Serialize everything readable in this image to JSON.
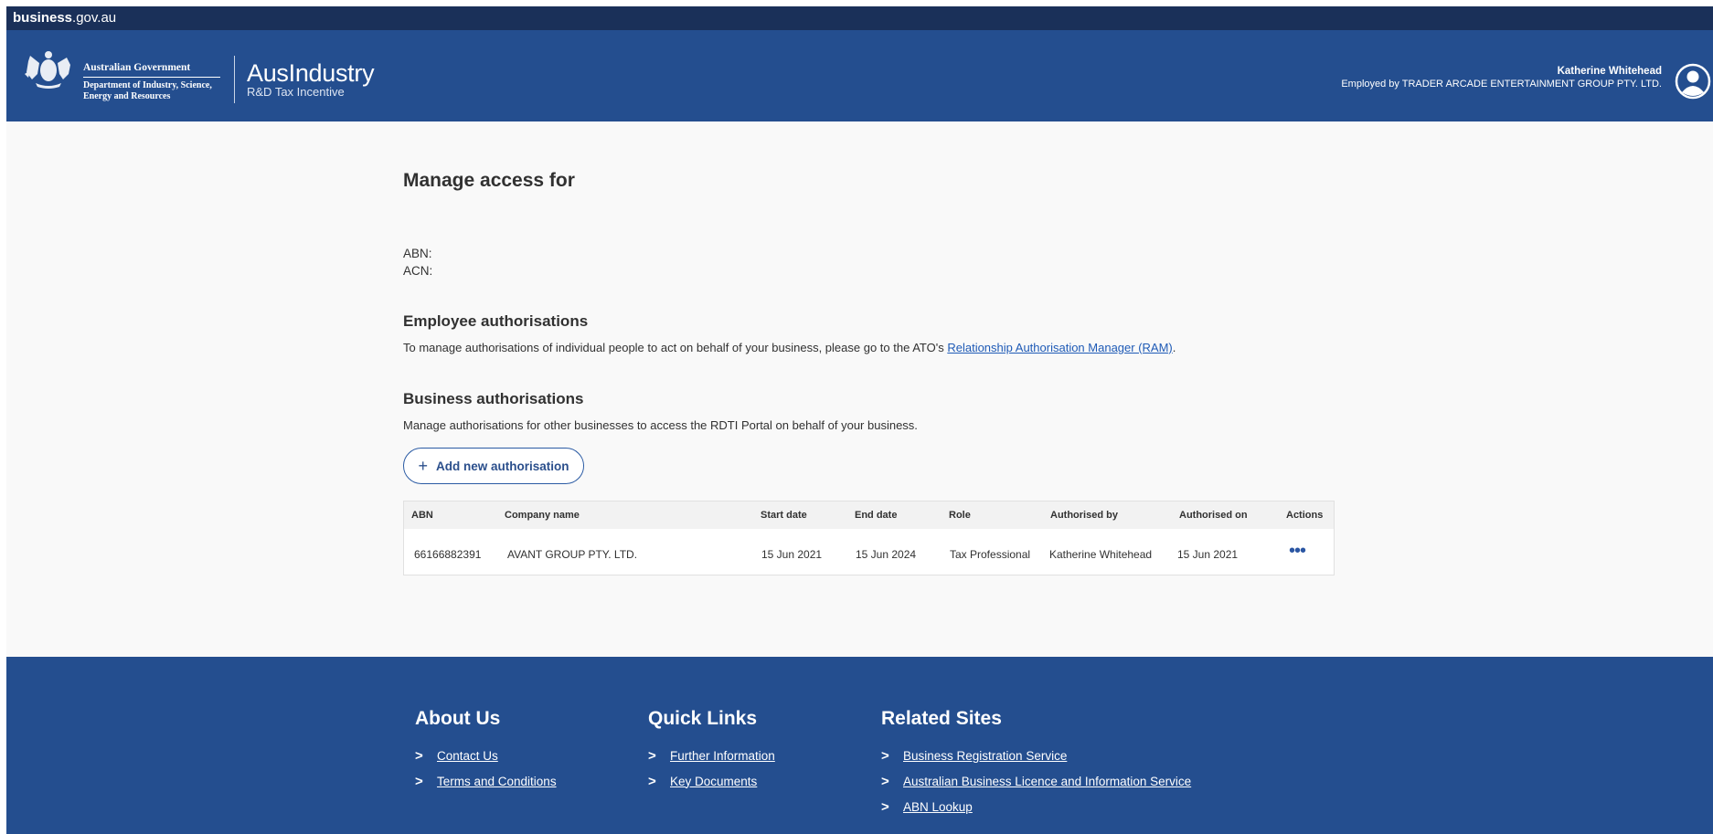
{
  "topstrip": {
    "brand_bold": "business",
    "brand_rest": ".gov.au"
  },
  "header": {
    "gov_name": "Australian Government",
    "dept_line1": "Department of Industry, Science,",
    "dept_line2": "Energy and Resources",
    "program_name": "AusIndustry",
    "program_sub": "R&D Tax Incentive",
    "user_name": "Katherine Whitehead",
    "user_employer": "Employed by TRADER ARCADE ENTERTAINMENT GROUP PTY. LTD."
  },
  "main": {
    "title": "Manage access for",
    "abn_label": "ABN:",
    "acn_label": "ACN:",
    "employee": {
      "heading": "Employee authorisations",
      "text": "To manage authorisations of individual people to act on behalf of your business, please go to the ATO's",
      "link": "Relationship Authorisation Manager (RAM)",
      "suffix": "."
    },
    "business": {
      "heading": "Business authorisations",
      "text": "Manage authorisations for other businesses to access the RDTI Portal on behalf of your business.",
      "add_button": "Add new authorisation",
      "add_icon": "+"
    },
    "table": {
      "columns": [
        "ABN",
        "Company name",
        "Start date",
        "End date",
        "Role",
        "Authorised by",
        "Authorised on",
        "Actions"
      ],
      "rows": [
        [
          "66166882391",
          "AVANT GROUP PTY. LTD.",
          "15 Jun 2021",
          "15 Jun 2024",
          "Tax Professional",
          "Katherine Whitehead",
          "15 Jun 2021"
        ]
      ],
      "actions_glyph": "•••"
    }
  },
  "footer": {
    "about": {
      "heading": "About Us",
      "links": [
        "Contact Us",
        "Terms and Conditions"
      ]
    },
    "quick": {
      "heading": "Quick Links",
      "links": [
        "Further Information",
        "Key Documents"
      ]
    },
    "related": {
      "heading": "Related Sites",
      "links": [
        "Business Registration Service",
        "Australian Business Licence and Information Service",
        "ABN Lookup"
      ]
    }
  },
  "colors": {
    "header_bg": "#244e8f",
    "topstrip_bg": "#1a3059",
    "link": "#1e5ab6",
    "page_bg": "#f9f9f9"
  }
}
